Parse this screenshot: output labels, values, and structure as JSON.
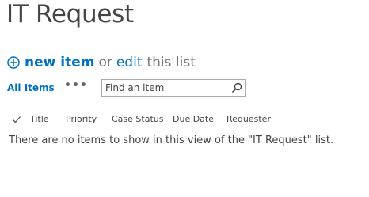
{
  "page": {
    "title": "IT Request"
  },
  "actions": {
    "new_item_label": "new item",
    "or_text": "or",
    "edit_label": "edit",
    "this_list_text": "this list"
  },
  "views": {
    "current_view": "All Items",
    "more_label": "•••",
    "search_placeholder": "Find an item"
  },
  "columns": [
    "Title",
    "Priority",
    "Case Status",
    "Due Date",
    "Requester"
  ],
  "empty_message": "There are no items to show in this view of the \"IT Request\" list.",
  "colors": {
    "accent": "#0072c6",
    "text": "#444444",
    "muted": "#777777"
  }
}
